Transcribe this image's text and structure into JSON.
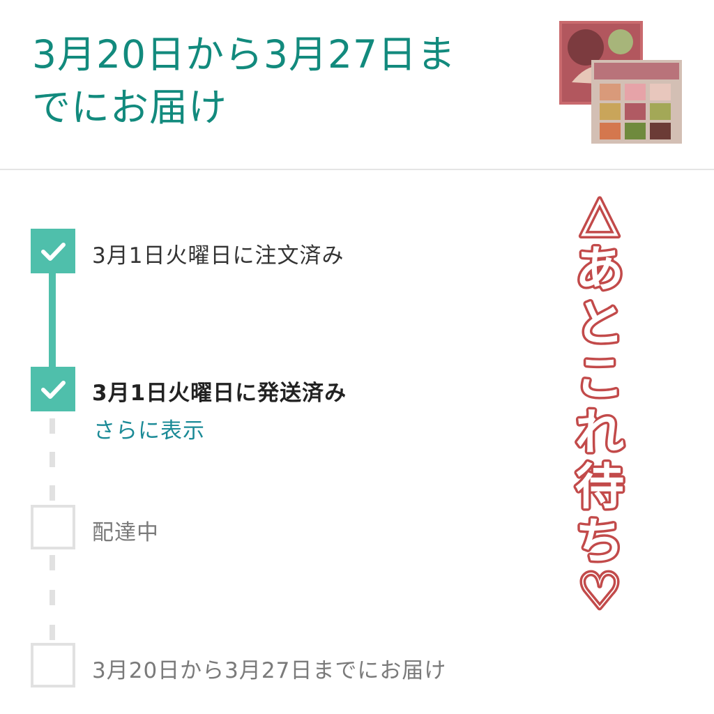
{
  "header": {
    "delivery_title_line1": "3月20日から3月27日ま",
    "delivery_title_line2": "でにお届け"
  },
  "tracking": {
    "steps": [
      {
        "label": "3月1日火曜日に注文済み",
        "status": "done"
      },
      {
        "label": "3月1日火曜日に発送済み",
        "status": "done"
      },
      {
        "label": "配達中",
        "status": "pending"
      },
      {
        "label": "3月20日から3月27日までにお届け",
        "status": "pending"
      }
    ],
    "more_link": "さらに表示"
  },
  "overlay": {
    "text": "△あとこれ待ち♡",
    "chars": [
      "△",
      "あ",
      "と",
      "こ",
      "れ",
      "待",
      "ち",
      "♡"
    ]
  },
  "colors": {
    "teal_heading": "#128a7d",
    "check_fill": "#4fbfab",
    "link": "#1a8a96",
    "overlay_fill": "#c24a4a",
    "pending_border": "#e1e1e1"
  }
}
